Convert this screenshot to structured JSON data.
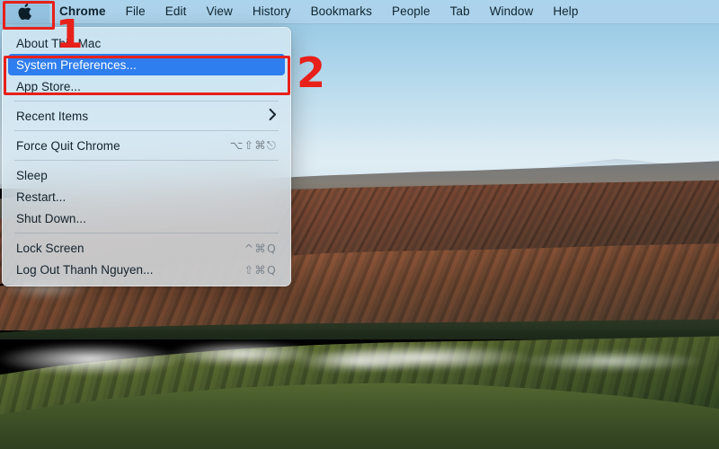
{
  "os": "macOS",
  "menubar": {
    "apple_icon": "apple-logo-icon",
    "items": [
      {
        "label": "Chrome",
        "bold": true
      },
      {
        "label": "File",
        "bold": false
      },
      {
        "label": "Edit",
        "bold": false
      },
      {
        "label": "View",
        "bold": false
      },
      {
        "label": "History",
        "bold": false
      },
      {
        "label": "Bookmarks",
        "bold": false
      },
      {
        "label": "People",
        "bold": false
      },
      {
        "label": "Tab",
        "bold": false
      },
      {
        "label": "Window",
        "bold": false
      },
      {
        "label": "Help",
        "bold": false
      }
    ]
  },
  "apple_menu": {
    "items": [
      {
        "label": "About This Mac",
        "shortcut": "",
        "submenu": false,
        "selected": false
      },
      {
        "label": "System Preferences...",
        "shortcut": "",
        "submenu": false,
        "selected": true
      },
      {
        "label": "App Store...",
        "shortcut": "",
        "submenu": false,
        "selected": false
      },
      {
        "label": "Recent Items",
        "shortcut": "",
        "submenu": true,
        "selected": false
      },
      {
        "label": "Force Quit Chrome",
        "shortcut": "⌥⇧⌘⎋",
        "submenu": false,
        "selected": false
      },
      {
        "label": "Sleep",
        "shortcut": "",
        "submenu": false,
        "selected": false
      },
      {
        "label": "Restart...",
        "shortcut": "",
        "submenu": false,
        "selected": false
      },
      {
        "label": "Shut Down...",
        "shortcut": "",
        "submenu": false,
        "selected": false
      },
      {
        "label": "Lock Screen",
        "shortcut": "^⌘Q",
        "submenu": false,
        "selected": false
      },
      {
        "label": "Log Out Thanh Nguyen...",
        "shortcut": "⇧⌘Q",
        "submenu": false,
        "selected": false
      }
    ],
    "submenu_chevron": "›",
    "highlight_color": "#2f7ef0"
  },
  "annotations": {
    "color": "#e8201a",
    "step1": "1",
    "step2": "2"
  },
  "wallpaper": {
    "name": "big-sur-california-hills",
    "sky_top_color": "#8cc3e2",
    "sky_bottom_color": "#d7e6ef",
    "ridge_color": "#8e5a42",
    "green_hill_color": "#526432"
  }
}
